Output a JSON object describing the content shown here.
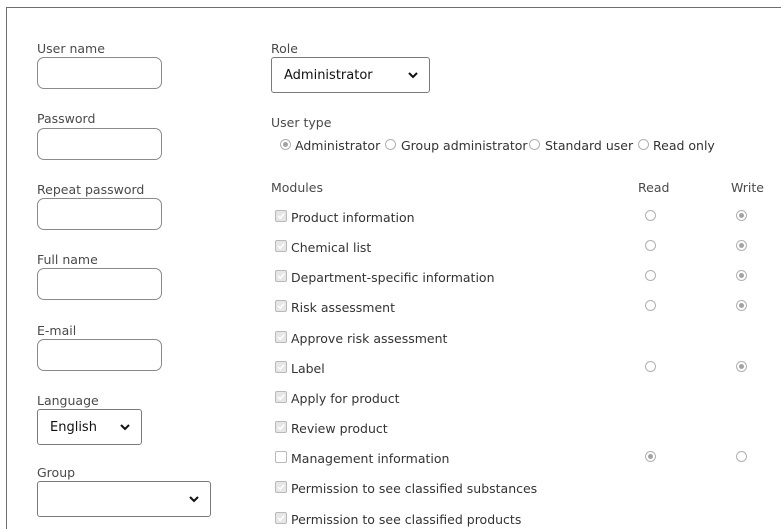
{
  "left": {
    "username_label": "User name",
    "password_label": "Password",
    "repeat_password_label": "Repeat password",
    "fullname_label": "Full name",
    "email_label": "E-mail",
    "language_label": "Language",
    "language_value": "English",
    "group_label": "Group",
    "group_value": ""
  },
  "role": {
    "label": "Role",
    "value": "Administrator"
  },
  "user_type": {
    "label": "User type",
    "options": [
      "Administrator",
      "Group administrator",
      "Standard user",
      "Read only"
    ],
    "selected": "Administrator"
  },
  "modules": {
    "header": "Modules",
    "read_header": "Read",
    "write_header": "Write",
    "items": [
      {
        "label": "Product information",
        "checked": true,
        "access": "write"
      },
      {
        "label": "Chemical list",
        "checked": true,
        "access": "write"
      },
      {
        "label": "Department-specific information",
        "checked": true,
        "access": "write"
      },
      {
        "label": "Risk assessment",
        "checked": true,
        "access": "write"
      },
      {
        "label": "Approve risk assessment",
        "checked": true,
        "access": null
      },
      {
        "label": "Label",
        "checked": true,
        "access": "write"
      },
      {
        "label": "Apply for product",
        "checked": true,
        "access": null
      },
      {
        "label": "Review product",
        "checked": true,
        "access": null
      },
      {
        "label": "Management information",
        "checked": false,
        "access": "read"
      },
      {
        "label": "Permission to see classified substances",
        "checked": true,
        "access": null
      },
      {
        "label": "Permission to see classified products",
        "checked": true,
        "access": null
      }
    ]
  }
}
